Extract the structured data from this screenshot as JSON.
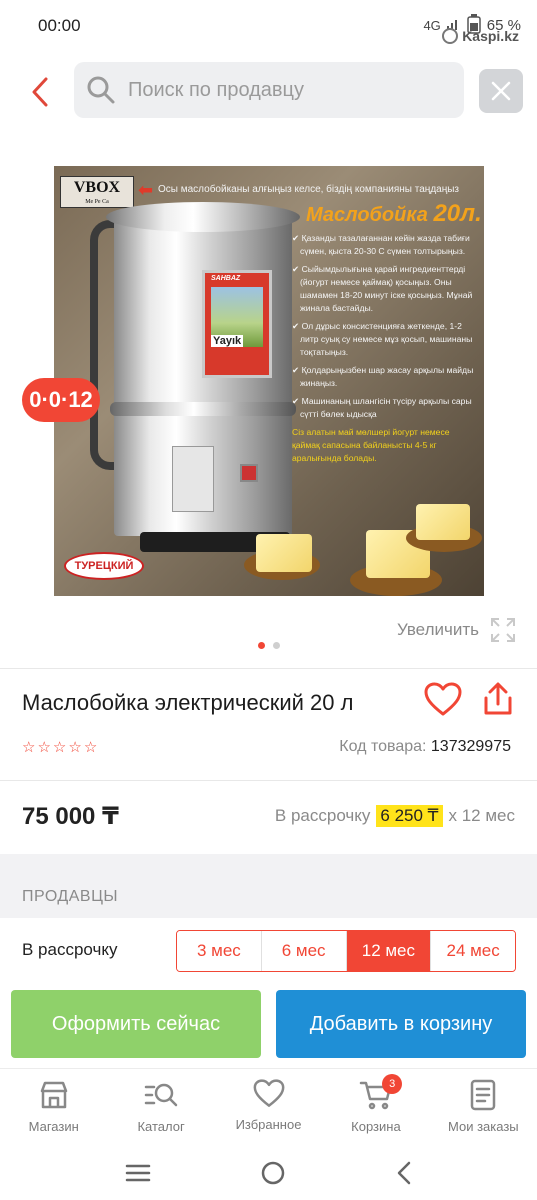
{
  "status": {
    "time": "00:00",
    "network": "4G",
    "battery": "65 %",
    "watermark": "Kaspi.kz"
  },
  "search": {
    "placeholder": "Поиск по продавцу"
  },
  "image": {
    "vbox": "VBOX",
    "vbox_sub": "Ме Ре Са",
    "headline": "Осы маслобойканы алғыңыз келсе, біздің компанияны таңдаңыз",
    "title_word": "Маслобойка",
    "title_size": "20л.",
    "bullets": [
      "Қазанды тазалағаннан кейін жазда табиғи сүмен, қыста 20-30 С сүмен толтырыңыз.",
      "Сыйымдылығына қарай ингредиенттерді (йогурт немесе қаймақ) қосыңыз. Оны шамамен 18-20 минут іске қосыңыз. Мұнай жинала бастайды.",
      "Ол дұрыс консистенцияға жеткенде, 1-2 литр суық су немесе мұз қосып, машинаны тоқтатыңыз.",
      "Қолдарыңызбен шар жасау арқылы майды жинаңыз.",
      "Машинаның шлангісін түсіру арқылы сары сүтті бөлек ыдысқа"
    ],
    "yellow_note": "Сіз алатын май мөлшері йогурт немесе қаймақ сапасына байланысты 4-5 кг аралығында болады.",
    "label_brand": "SAHBAZ",
    "label_name": "Yayık",
    "label_sub": "Makinası",
    "badge_turkish": "ТУРЕЦКИЙ"
  },
  "promo_badge": "0·0·12",
  "zoom_label": "Увеличить",
  "product": {
    "title": "Маслобойка электрический 20 л",
    "sku_label": "Код товара:",
    "sku_value": "137329975",
    "rating_stars": 0,
    "price": "75 000 ₸",
    "installment_prefix": "В рассрочку",
    "installment_amount": "6 250 ₸",
    "installment_suffix": "x 12 мес"
  },
  "sellers_heading": "ПРОДАВЦЫ",
  "installment_row": {
    "label": "В рассрочку",
    "options": [
      "3 мес",
      "6 мес",
      "12 мес",
      "24 мес"
    ],
    "selected": "12 мес"
  },
  "actions": {
    "checkout": "Оформить сейчас",
    "add_to_cart": "Добавить в корзину"
  },
  "bottom_nav": [
    {
      "label": "Магазин",
      "icon": "store-icon"
    },
    {
      "label": "Каталог",
      "icon": "catalog-search-icon"
    },
    {
      "label": "Избранное",
      "icon": "heart-icon"
    },
    {
      "label": "Корзина",
      "icon": "cart-icon",
      "badge": "3"
    },
    {
      "label": "Мои заказы",
      "icon": "orders-icon"
    }
  ],
  "colors": {
    "accent": "#f14635",
    "checkout": "#8fd16a",
    "cart": "#1f8fd6",
    "highlight": "#ffe31a"
  }
}
